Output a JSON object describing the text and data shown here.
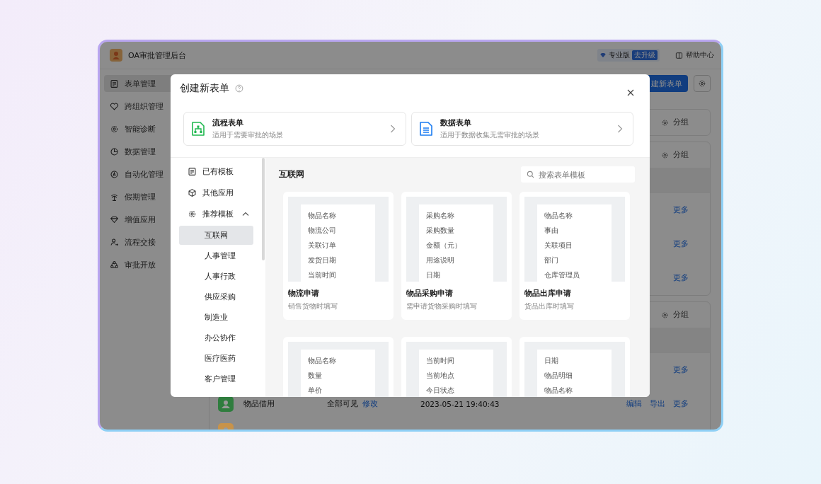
{
  "app": {
    "title": "OA审批管理后台",
    "edition": "专业版",
    "upgrade": "去升级",
    "help": "帮助中心"
  },
  "sidebar": {
    "items": [
      {
        "label": "表单管理",
        "selected": true
      },
      {
        "label": "跨组织管理",
        "selected": false
      },
      {
        "label": "智能诊断",
        "selected": false
      },
      {
        "label": "数据管理",
        "selected": false
      },
      {
        "label": "自动化管理",
        "selected": false
      },
      {
        "label": "假期管理",
        "selected": false
      },
      {
        "label": "增值应用",
        "selected": false
      },
      {
        "label": "流程交接",
        "selected": false
      },
      {
        "label": "审批开放",
        "selected": false
      }
    ]
  },
  "toolbar": {
    "create_button": "建新表单"
  },
  "groups": [
    {
      "action": "分组"
    },
    {
      "action": "分组",
      "rows": [
        {
          "more": "更多"
        },
        {
          "more": "更多"
        },
        {
          "more": "更多"
        }
      ]
    },
    {
      "action": "分组",
      "rows": [
        {
          "more": "更多"
        },
        {
          "color": "#2f7d3e",
          "name": "物品借用",
          "visibility": "全部可见",
          "modify": "修改",
          "time": "2023-05-21 19:40:43",
          "edit": "编辑",
          "export": "导出",
          "more": "更多"
        },
        {
          "color": "#c8934a"
        }
      ]
    }
  ],
  "dialog": {
    "title": "创建新表单",
    "types": [
      {
        "kind": "flow",
        "name": "流程表单",
        "desc": "适用于需要审批的场景"
      },
      {
        "kind": "data",
        "name": "数据表单",
        "desc": "适用于数据收集无需审批的场景"
      }
    ],
    "nav": [
      {
        "label": "已有模板",
        "selected": false
      },
      {
        "label": "其他应用",
        "selected": false
      },
      {
        "label": "推荐模板",
        "selected": false,
        "expanded": true,
        "children": [
          {
            "label": "互联网",
            "selected": true
          },
          {
            "label": "人事管理",
            "selected": false
          },
          {
            "label": "人事行政",
            "selected": false
          },
          {
            "label": "供应采购",
            "selected": false
          },
          {
            "label": "制造业",
            "selected": false
          },
          {
            "label": "办公协作",
            "selected": false
          },
          {
            "label": "医疗医药",
            "selected": false
          },
          {
            "label": "客户管理",
            "selected": false
          }
        ]
      }
    ],
    "category_title": "互联网",
    "search": {
      "placeholder": "搜索表单模板"
    },
    "templates": [
      {
        "name": "物流申请",
        "desc": "销售货物时填写",
        "fields": [
          "物品名称",
          "物流公司",
          "关联订单",
          "发货日期",
          "当前时间"
        ]
      },
      {
        "name": "物品采购申请",
        "desc": "需申请货物采购时填写",
        "fields": [
          "采购名称",
          "采购数量",
          "金额（元）",
          "用途说明",
          "日期"
        ]
      },
      {
        "name": "物品出库申请",
        "desc": "货品出库时填写",
        "fields": [
          "物品名称",
          "事由",
          "关联项目",
          "部门",
          "仓库管理员"
        ]
      },
      {
        "fields": [
          "物品名称",
          "数量",
          "单价"
        ]
      },
      {
        "fields": [
          "当前时间",
          "当前地点",
          "今日状态"
        ]
      },
      {
        "fields": [
          "日期",
          "物品明细",
          "物品名称"
        ]
      }
    ]
  }
}
